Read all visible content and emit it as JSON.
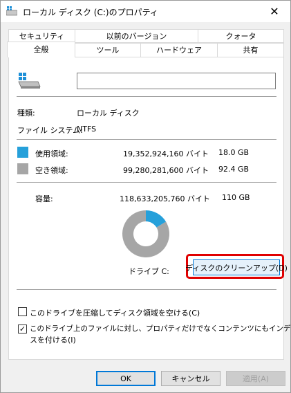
{
  "window": {
    "title": "ローカル ディスク (C:)のプロパティ",
    "close_glyph": "✕"
  },
  "tabs": {
    "row1": [
      {
        "label": "セキュリティ"
      },
      {
        "label": "以前のバージョン"
      },
      {
        "label": "クォータ"
      }
    ],
    "row2": [
      {
        "label": "全般",
        "active": true
      },
      {
        "label": "ツール"
      },
      {
        "label": "ハードウェア"
      },
      {
        "label": "共有"
      }
    ]
  },
  "general": {
    "drive_icon": "drive-windows-icon",
    "volume_name_value": "",
    "type_label": "種類:",
    "type_value": "ローカル ディスク",
    "filesystem_label": "ファイル システム:",
    "filesystem_value": "NTFS",
    "used": {
      "label": "使用領域:",
      "bytes": "19,352,924,160 バイト",
      "size": "18.0 GB",
      "color": "#26a0da"
    },
    "free": {
      "label": "空き領域:",
      "bytes": "99,280,281,600 バイト",
      "size": "92.4 GB",
      "color": "#a6a6a6"
    },
    "capacity": {
      "label": "容量:",
      "bytes": "118,633,205,760 バイト",
      "size": "110 GB"
    },
    "drive_label": "ドライブ C:",
    "cleanup_button": "ディスクのクリーンアップ(D)",
    "compress_checkbox": {
      "label": "このドライブを圧縮してディスク領域を空ける(C)",
      "checked": false
    },
    "index_checkbox": {
      "label_line1": "このドライブ上のファイルに対し、プロパティだけでなくコンテンツにもインデック",
      "label_line2": "スを付ける(I)",
      "checked": true,
      "check_glyph": "✓"
    }
  },
  "chart_data": {
    "type": "pie",
    "categories": [
      "使用領域",
      "空き領域"
    ],
    "values": [
      19352924160,
      99280281600
    ],
    "colors": [
      "#26a0da",
      "#a6a6a6"
    ]
  },
  "buttons": {
    "ok": "OK",
    "cancel": "キャンセル",
    "apply": "適用(A)"
  }
}
